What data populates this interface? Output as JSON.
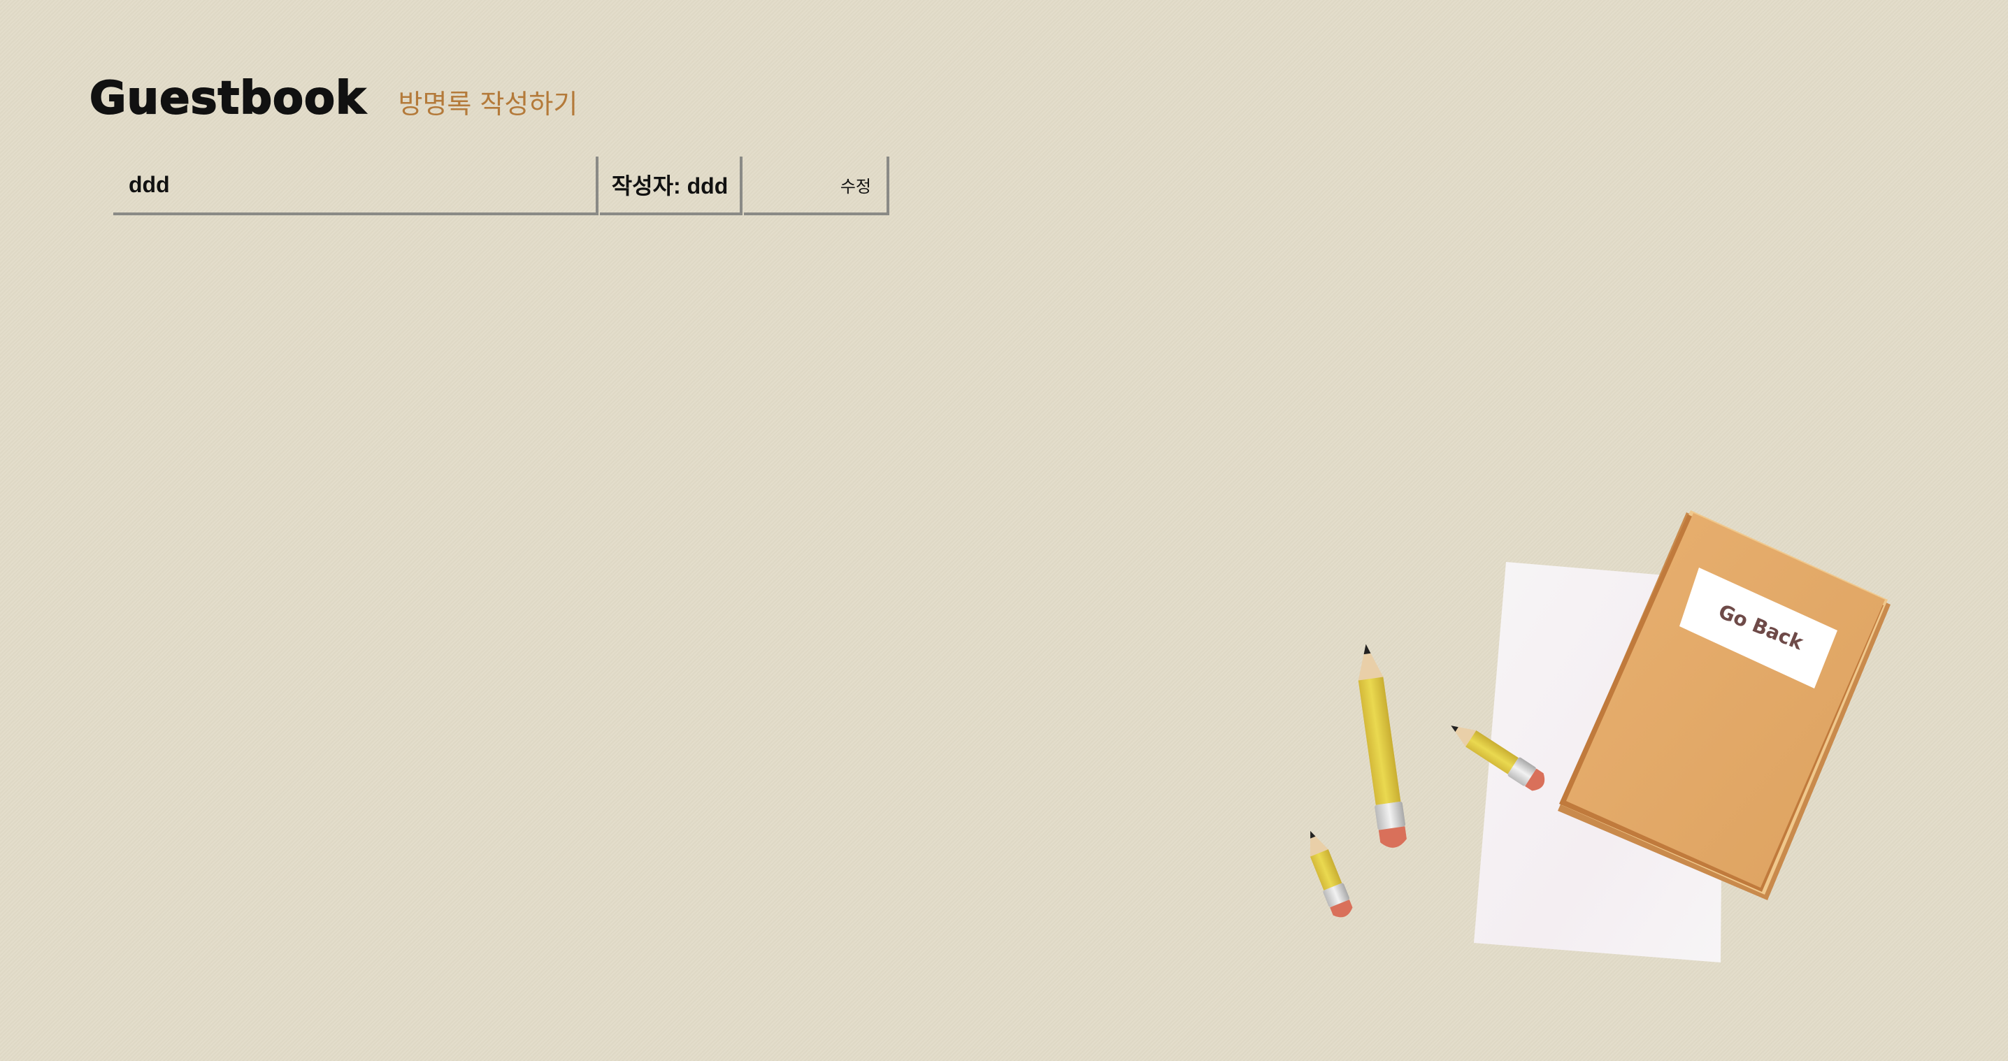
{
  "header": {
    "title": "Guestbook",
    "write_link": "방명록 작성하기"
  },
  "entries": [
    {
      "content": "ddd",
      "author_label": "작성자: ddd",
      "edit_label": "수정"
    }
  ],
  "notebook": {
    "label": "Go Back"
  },
  "colors": {
    "background": "#e2dbc8",
    "accent": "#b47a3a",
    "notebook": "#e2ac6a",
    "pencil": "#e6d24c",
    "eraser": "#d9705a"
  }
}
